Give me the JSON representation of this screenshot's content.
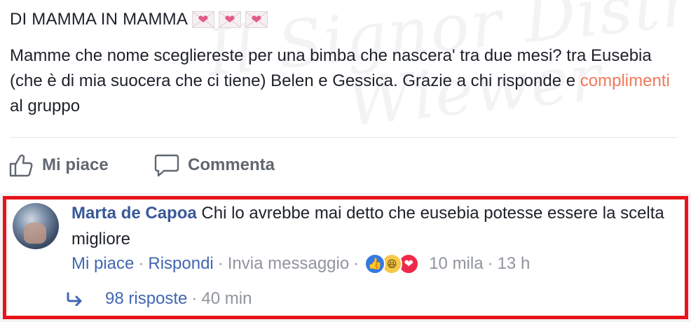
{
  "post": {
    "group_title": "DI MAMMA IN MAMMA",
    "heart_glyph": "❤",
    "heart_count": 3,
    "body_before": "Mamme che nome scegliereste per una bimba che nascera' tra due mesi? tra Eusebia (che è di mia suocera che ci tiene) Belen e Gessica. Grazie a chi risponde e ",
    "body_highlight": "complimenti",
    "body_after": " al gruppo"
  },
  "watermark": {
    "line1": "Il Signor Distruggere",
    "line2": "Wiewer"
  },
  "actions": {
    "like_label": "Mi piace",
    "comment_label": "Commenta"
  },
  "comment": {
    "author": "Marta de Capoa",
    "text": "Chi lo avrebbe mai detto che eusebia potesse essere la scelta migliore",
    "like_label": "Mi piace",
    "reply_label": "Rispondi",
    "message_label": "Invia messaggio",
    "reaction_count": "10 mila",
    "time": "13 h",
    "reactions": [
      "like-reaction-icon",
      "haha-reaction-icon",
      "love-reaction-icon"
    ]
  },
  "replies": {
    "label": "98 risposte",
    "time": "40 min"
  },
  "colors": {
    "link": "#4267b2",
    "author": "#385898",
    "highlight": "#f0785a",
    "muted": "#90949c",
    "frame": "#e8141a"
  }
}
